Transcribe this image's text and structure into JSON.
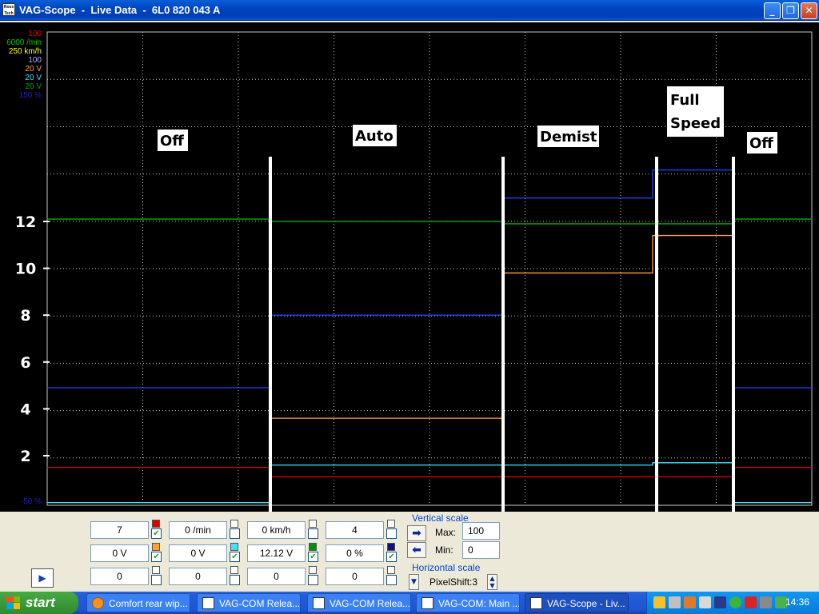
{
  "window": {
    "title": "VAG-Scope  -  Live Data  -  6L0 820 043 A",
    "app_icon_text": "Ross Tech",
    "minimize_glyph": "_",
    "maximize_glyph": "❐",
    "close_glyph": "✕"
  },
  "scope": {
    "channel_scale_labels": [
      {
        "text": "100",
        "color": "#e00000"
      },
      {
        "text": "6000 /min",
        "color": "#00c800"
      },
      {
        "text": "250 km/h",
        "color": "#ffff00"
      },
      {
        "text": "100",
        "color": "#b0b0ff"
      },
      {
        "text": "20 V",
        "color": "#ffa040"
      },
      {
        "text": "20 V",
        "color": "#40e0ff"
      },
      {
        "text": "20 V",
        "color": "#00a000"
      },
      {
        "text": "150 %",
        "color": "#2020c0"
      }
    ],
    "min_label": "-50 %",
    "annotations": [
      "Off",
      "Auto",
      "Demist",
      "Full Speed",
      "Off"
    ],
    "y_tick_labels": [
      "12",
      "10",
      "8",
      "6",
      "4",
      "2"
    ]
  },
  "chart_data": {
    "type": "line",
    "x_axis": "time (unlabeled)",
    "phases": [
      "Off",
      "Auto",
      "Demist",
      "Full Speed",
      "Off"
    ],
    "y_ticks": [
      12,
      10,
      8,
      6,
      4,
      2
    ],
    "series": [
      {
        "name": "green 20 V",
        "color": "#00b000",
        "values": [
          12.1,
          12.0,
          11.9,
          11.9,
          12.1
        ]
      },
      {
        "name": "orange 20 V",
        "color": "#ffa040",
        "values": [
          0,
          3.6,
          9.8,
          11.4,
          0
        ]
      },
      {
        "name": "dark blue 150 %",
        "color": "#2040ff",
        "values": [
          4.9,
          8.0,
          13.0,
          14.2,
          4.9
        ]
      },
      {
        "name": "cyan 20 V",
        "color": "#40e0ff",
        "values": [
          0,
          1.6,
          1.6,
          1.7,
          0
        ]
      },
      {
        "name": "red 100",
        "color": "#e00000",
        "values": [
          1.5,
          1.1,
          1.1,
          1.1,
          1.5
        ]
      }
    ]
  },
  "channels": {
    "row1": [
      {
        "value": "7",
        "color": "#e00000",
        "checked": true
      },
      {
        "value": "0 /min",
        "color": "#ffffff",
        "checked": false
      },
      {
        "value": "0 km/h",
        "color": "#ffffff",
        "checked": false
      },
      {
        "value": "4",
        "color": "#ffffff",
        "checked": false
      }
    ],
    "row2": [
      {
        "value": "0 V",
        "color": "#ffa030",
        "checked": true
      },
      {
        "value": "0 V",
        "color": "#40e0ff",
        "checked": true
      },
      {
        "value": "12.12 V",
        "color": "#009000",
        "checked": true
      },
      {
        "value": "0 %",
        "color": "#10107a",
        "checked": true
      }
    ],
    "row3": [
      {
        "value": "0",
        "color": "#ffffff",
        "checked": false
      },
      {
        "value": "0",
        "color": "#ffffff",
        "checked": false
      },
      {
        "value": "0",
        "color": "#ffffff",
        "checked": false
      },
      {
        "value": "0",
        "color": "#ffffff",
        "checked": false
      }
    ]
  },
  "vertical_scale": {
    "label": "Vertical scale",
    "max_label": "Max:",
    "max_value": "100",
    "min_label": "Min:",
    "min_value": "0"
  },
  "horizontal_scale": {
    "label": "Horizontal scale",
    "value": "PixelShift:3"
  },
  "taskbar": {
    "start_label": "start",
    "buttons": [
      {
        "label": "Comfort rear wip...",
        "icon": "firefox-icon",
        "active": false
      },
      {
        "label": "VAG-COM Relea...",
        "icon": "rosstech-icon",
        "active": false
      },
      {
        "label": "VAG-COM Relea...",
        "icon": "rosstech-icon",
        "active": false
      },
      {
        "label": "VAG-COM: Main ...",
        "icon": "vagcom-icon",
        "active": false
      },
      {
        "label": "VAG-Scope  -  Liv...",
        "icon": "rosstech-icon",
        "active": true
      }
    ],
    "clock": "14:36"
  }
}
